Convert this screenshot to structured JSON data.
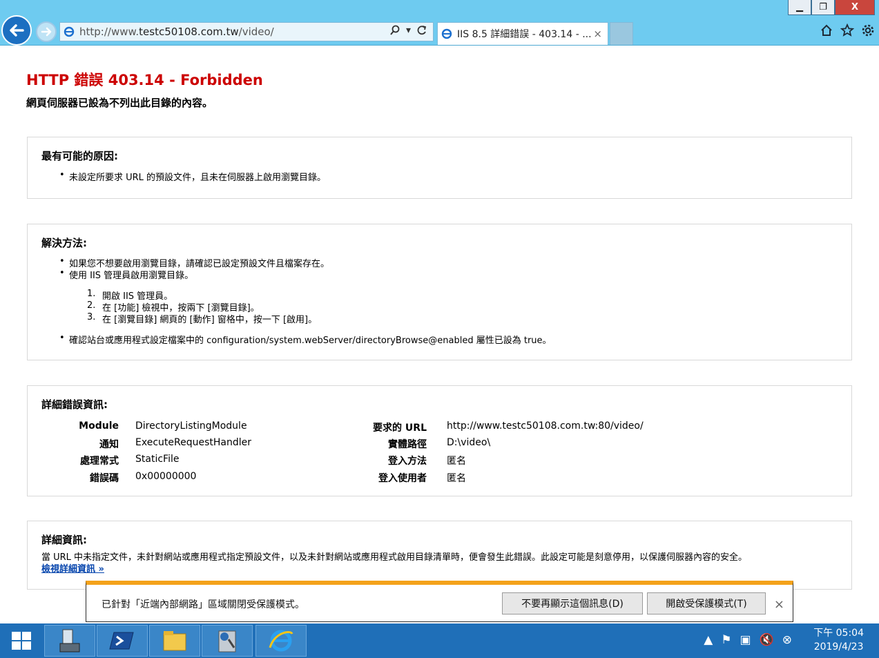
{
  "browser": {
    "url_prefix": "http://www.",
    "url_domain": "testc50108.com.tw",
    "url_path": "/video/",
    "tab_title": "IIS 8.5 詳細錯誤 - 403.14 - ...",
    "tab_close": "×",
    "window_controls": {
      "minimize": "▁",
      "restore": "❐",
      "close": "X"
    },
    "icons": [
      "back-arrow-icon",
      "forward-arrow-icon",
      "ie-icon",
      "search-icon",
      "refresh-icon",
      "home-icon",
      "favorites-star-icon",
      "settings-gear-icon"
    ]
  },
  "error": {
    "title": "HTTP 錯誤 403.14 - Forbidden",
    "subtitle": "網頁伺服器已設為不列出此目錄的內容。"
  },
  "causes": {
    "heading": "最有可能的原因:",
    "items": [
      "未設定所要求 URL 的預設文件，且未在伺服器上啟用瀏覽目錄。"
    ]
  },
  "solutions": {
    "heading": "解決方法:",
    "bullet1": "如果您不想要啟用瀏覽目錄，請確認已設定預設文件且檔案存在。",
    "bullet2": "使用 IIS 管理員啟用瀏覽目錄。",
    "steps": [
      {
        "n": "1.",
        "text": "開啟 IIS 管理員。"
      },
      {
        "n": "2.",
        "text": "在 [功能] 檢視中，按兩下 [瀏覽目錄]。"
      },
      {
        "n": "3.",
        "text": "在 [瀏覽目錄] 網頁的 [動作] 窗格中，按一下 [啟用]。"
      }
    ],
    "bullet3": "確認站台或應用程式設定檔案中的 configuration/system.webServer/directoryBrowse@enabled 屬性已設為 true。"
  },
  "details": {
    "heading": "詳細錯誤資訊:",
    "left": [
      {
        "k": "Module",
        "v": "DirectoryListingModule"
      },
      {
        "k": "通知",
        "v": "ExecuteRequestHandler"
      },
      {
        "k": "處理常式",
        "v": "StaticFile"
      },
      {
        "k": "錯誤碼",
        "v": "0x00000000"
      }
    ],
    "right": [
      {
        "k": "要求的 URL",
        "v": "http://www.testc50108.com.tw:80/video/"
      },
      {
        "k": "實體路徑",
        "v": "D:\\video\\"
      },
      {
        "k": "登入方法",
        "v": "匿名"
      },
      {
        "k": "登入使用者",
        "v": "匿名"
      }
    ]
  },
  "more_info": {
    "heading": "詳細資訊:",
    "text": "當 URL 中未指定文件，未針對網站或應用程式指定預設文件，以及未針對網站或應用程式啟用目錄清單時，便會發生此錯誤。此設定可能是刻意停用，以保護伺服器內容的安全。",
    "link": "檢視詳細資訊 »"
  },
  "notification": {
    "text": "已針對「近端內部網路」區域關閉受保護模式。",
    "button1": "不要再顯示這個訊息(D)",
    "button2": "開啟受保護模式(T)",
    "close": "×"
  },
  "taskbar": {
    "apps": [
      "server-manager-icon",
      "powershell-icon",
      "file-explorer-icon",
      "admin-tools-icon",
      "internet-explorer-icon"
    ],
    "clock_time": "下午 05:04",
    "clock_date": "2019/4/23"
  },
  "colors": {
    "chrome": "#6ecbf0",
    "error_red": "#cc0000",
    "link_blue": "#0645ad",
    "notify_accent": "#f4a21a",
    "taskbar": "#1f6fb8"
  }
}
